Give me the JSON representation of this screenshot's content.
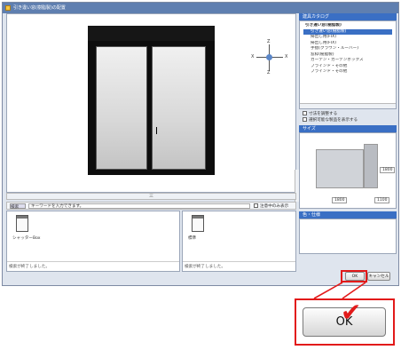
{
  "window": {
    "title": "引き違い窓(樹脂製)の配置"
  },
  "preview": {
    "compass": {
      "north": "Z",
      "south": "Z",
      "west": "X",
      "east": "X"
    },
    "hscroll_label": "三"
  },
  "panel": {
    "catalog_header": "建具カタログ",
    "tree_items": [
      "引き違い窓(樹脂製)",
      "引き違い窓(樹脂製)",
      "掃出し用(FIX)",
      "掃出し用(FIX)",
      "手摺(クラウン・ルーバー)",
      "窓枠(樹脂製)",
      "カーテン・カーテンボックス",
      "ブラインド・その他",
      "ブラインド・その他"
    ],
    "selected_index": 1,
    "options": [
      "寸法を調整する",
      "選択可能な製品を表示する"
    ],
    "size_header": "サイズ",
    "dims": {
      "width": "1800",
      "height": "1800",
      "depth": "1100"
    },
    "color_header": "色・仕様"
  },
  "search": {
    "button": "検索",
    "placeholder": "キーワードを入力できます。",
    "option": "注意中のみ表示"
  },
  "library": {
    "left": {
      "item": "シャッターBox",
      "status": "検索が終了しました。"
    },
    "right": {
      "item": "標準",
      "status": "検索が終了しました。"
    }
  },
  "buttons": {
    "ok": "OK",
    "cancel": "キャンセル"
  },
  "callout": {
    "ok_large": "OK"
  },
  "colors": {
    "highlight": "#e21a1a",
    "selection": "#3a6fc4"
  }
}
